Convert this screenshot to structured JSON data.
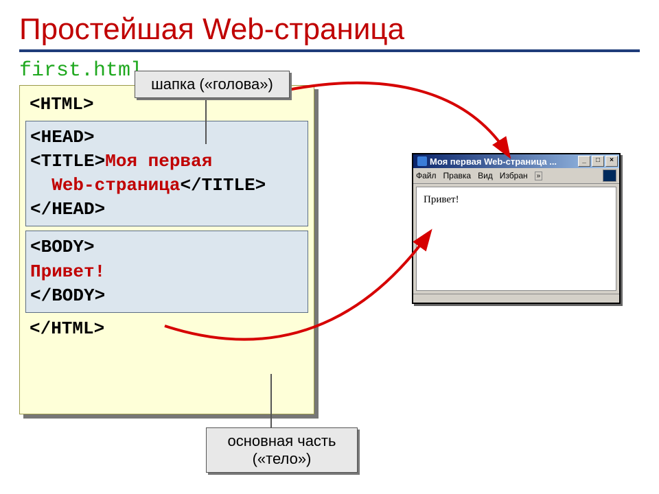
{
  "slide": {
    "title": "Простейшая Web-страница",
    "filename": "first.html"
  },
  "code": {
    "html_open": "<HTML>",
    "head_open": "<HEAD>",
    "title_open": "<TITLE>",
    "title_text_line1": "Моя первая",
    "title_text_line2": "Web-страница",
    "title_close": "</TITLE>",
    "head_close": "</HEAD>",
    "body_open": "<BODY>",
    "body_text": "Привет!",
    "body_close": "</BODY>",
    "html_close": "</HTML>"
  },
  "callouts": {
    "head_label": "шапка («голова»)",
    "body_label_line1": "основная часть",
    "body_label_line2": "(«тело»)"
  },
  "browser": {
    "title": "Моя первая Web-страница ...",
    "menu": {
      "file": "Файл",
      "edit": "Правка",
      "view": "Вид",
      "favorites": "Избран"
    },
    "content": "Привет!"
  }
}
